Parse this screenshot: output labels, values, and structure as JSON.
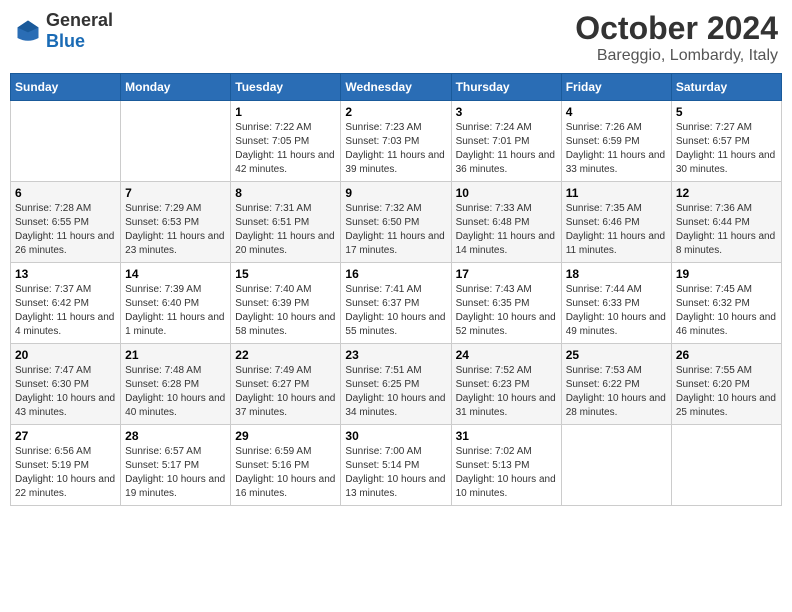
{
  "logo": {
    "general": "General",
    "blue": "Blue"
  },
  "header": {
    "month": "October 2024",
    "location": "Bareggio, Lombardy, Italy"
  },
  "days_of_week": [
    "Sunday",
    "Monday",
    "Tuesday",
    "Wednesday",
    "Thursday",
    "Friday",
    "Saturday"
  ],
  "weeks": [
    [
      {
        "day": "",
        "sunrise": "",
        "sunset": "",
        "daylight": ""
      },
      {
        "day": "",
        "sunrise": "",
        "sunset": "",
        "daylight": ""
      },
      {
        "day": "1",
        "sunrise": "Sunrise: 7:22 AM",
        "sunset": "Sunset: 7:05 PM",
        "daylight": "Daylight: 11 hours and 42 minutes."
      },
      {
        "day": "2",
        "sunrise": "Sunrise: 7:23 AM",
        "sunset": "Sunset: 7:03 PM",
        "daylight": "Daylight: 11 hours and 39 minutes."
      },
      {
        "day": "3",
        "sunrise": "Sunrise: 7:24 AM",
        "sunset": "Sunset: 7:01 PM",
        "daylight": "Daylight: 11 hours and 36 minutes."
      },
      {
        "day": "4",
        "sunrise": "Sunrise: 7:26 AM",
        "sunset": "Sunset: 6:59 PM",
        "daylight": "Daylight: 11 hours and 33 minutes."
      },
      {
        "day": "5",
        "sunrise": "Sunrise: 7:27 AM",
        "sunset": "Sunset: 6:57 PM",
        "daylight": "Daylight: 11 hours and 30 minutes."
      }
    ],
    [
      {
        "day": "6",
        "sunrise": "Sunrise: 7:28 AM",
        "sunset": "Sunset: 6:55 PM",
        "daylight": "Daylight: 11 hours and 26 minutes."
      },
      {
        "day": "7",
        "sunrise": "Sunrise: 7:29 AM",
        "sunset": "Sunset: 6:53 PM",
        "daylight": "Daylight: 11 hours and 23 minutes."
      },
      {
        "day": "8",
        "sunrise": "Sunrise: 7:31 AM",
        "sunset": "Sunset: 6:51 PM",
        "daylight": "Daylight: 11 hours and 20 minutes."
      },
      {
        "day": "9",
        "sunrise": "Sunrise: 7:32 AM",
        "sunset": "Sunset: 6:50 PM",
        "daylight": "Daylight: 11 hours and 17 minutes."
      },
      {
        "day": "10",
        "sunrise": "Sunrise: 7:33 AM",
        "sunset": "Sunset: 6:48 PM",
        "daylight": "Daylight: 11 hours and 14 minutes."
      },
      {
        "day": "11",
        "sunrise": "Sunrise: 7:35 AM",
        "sunset": "Sunset: 6:46 PM",
        "daylight": "Daylight: 11 hours and 11 minutes."
      },
      {
        "day": "12",
        "sunrise": "Sunrise: 7:36 AM",
        "sunset": "Sunset: 6:44 PM",
        "daylight": "Daylight: 11 hours and 8 minutes."
      }
    ],
    [
      {
        "day": "13",
        "sunrise": "Sunrise: 7:37 AM",
        "sunset": "Sunset: 6:42 PM",
        "daylight": "Daylight: 11 hours and 4 minutes."
      },
      {
        "day": "14",
        "sunrise": "Sunrise: 7:39 AM",
        "sunset": "Sunset: 6:40 PM",
        "daylight": "Daylight: 11 hours and 1 minute."
      },
      {
        "day": "15",
        "sunrise": "Sunrise: 7:40 AM",
        "sunset": "Sunset: 6:39 PM",
        "daylight": "Daylight: 10 hours and 58 minutes."
      },
      {
        "day": "16",
        "sunrise": "Sunrise: 7:41 AM",
        "sunset": "Sunset: 6:37 PM",
        "daylight": "Daylight: 10 hours and 55 minutes."
      },
      {
        "day": "17",
        "sunrise": "Sunrise: 7:43 AM",
        "sunset": "Sunset: 6:35 PM",
        "daylight": "Daylight: 10 hours and 52 minutes."
      },
      {
        "day": "18",
        "sunrise": "Sunrise: 7:44 AM",
        "sunset": "Sunset: 6:33 PM",
        "daylight": "Daylight: 10 hours and 49 minutes."
      },
      {
        "day": "19",
        "sunrise": "Sunrise: 7:45 AM",
        "sunset": "Sunset: 6:32 PM",
        "daylight": "Daylight: 10 hours and 46 minutes."
      }
    ],
    [
      {
        "day": "20",
        "sunrise": "Sunrise: 7:47 AM",
        "sunset": "Sunset: 6:30 PM",
        "daylight": "Daylight: 10 hours and 43 minutes."
      },
      {
        "day": "21",
        "sunrise": "Sunrise: 7:48 AM",
        "sunset": "Sunset: 6:28 PM",
        "daylight": "Daylight: 10 hours and 40 minutes."
      },
      {
        "day": "22",
        "sunrise": "Sunrise: 7:49 AM",
        "sunset": "Sunset: 6:27 PM",
        "daylight": "Daylight: 10 hours and 37 minutes."
      },
      {
        "day": "23",
        "sunrise": "Sunrise: 7:51 AM",
        "sunset": "Sunset: 6:25 PM",
        "daylight": "Daylight: 10 hours and 34 minutes."
      },
      {
        "day": "24",
        "sunrise": "Sunrise: 7:52 AM",
        "sunset": "Sunset: 6:23 PM",
        "daylight": "Daylight: 10 hours and 31 minutes."
      },
      {
        "day": "25",
        "sunrise": "Sunrise: 7:53 AM",
        "sunset": "Sunset: 6:22 PM",
        "daylight": "Daylight: 10 hours and 28 minutes."
      },
      {
        "day": "26",
        "sunrise": "Sunrise: 7:55 AM",
        "sunset": "Sunset: 6:20 PM",
        "daylight": "Daylight: 10 hours and 25 minutes."
      }
    ],
    [
      {
        "day": "27",
        "sunrise": "Sunrise: 6:56 AM",
        "sunset": "Sunset: 5:19 PM",
        "daylight": "Daylight: 10 hours and 22 minutes."
      },
      {
        "day": "28",
        "sunrise": "Sunrise: 6:57 AM",
        "sunset": "Sunset: 5:17 PM",
        "daylight": "Daylight: 10 hours and 19 minutes."
      },
      {
        "day": "29",
        "sunrise": "Sunrise: 6:59 AM",
        "sunset": "Sunset: 5:16 PM",
        "daylight": "Daylight: 10 hours and 16 minutes."
      },
      {
        "day": "30",
        "sunrise": "Sunrise: 7:00 AM",
        "sunset": "Sunset: 5:14 PM",
        "daylight": "Daylight: 10 hours and 13 minutes."
      },
      {
        "day": "31",
        "sunrise": "Sunrise: 7:02 AM",
        "sunset": "Sunset: 5:13 PM",
        "daylight": "Daylight: 10 hours and 10 minutes."
      },
      {
        "day": "",
        "sunrise": "",
        "sunset": "",
        "daylight": ""
      },
      {
        "day": "",
        "sunrise": "",
        "sunset": "",
        "daylight": ""
      }
    ]
  ]
}
